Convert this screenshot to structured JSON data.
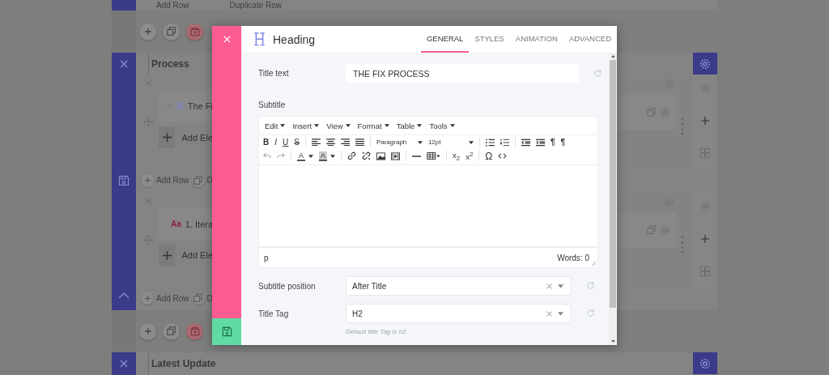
{
  "builder": {
    "top_row": {
      "add": "Add Row",
      "duplicate": "Duplicate Row"
    },
    "sections": [
      {
        "title": "Process",
        "rows": [
          {
            "kind": "heading",
            "label": "The Fi",
            "add_label": "Add Ele",
            "add_row": "Add Row",
            "duplicate": "D"
          },
          {
            "kind": "text",
            "badge": "Aa",
            "label": "1. Itera",
            "add_label": "Add Ele",
            "add_row": "Add Row",
            "duplicate": "D"
          }
        ]
      },
      {
        "title": "Latest Update"
      }
    ]
  },
  "modal": {
    "title": "Heading",
    "tabs": [
      {
        "label": "GENERAL",
        "selected": true
      },
      {
        "label": "STYLES",
        "selected": false
      },
      {
        "label": "ANIMATION",
        "selected": false
      },
      {
        "label": "ADVANCED",
        "selected": false
      }
    ],
    "fields": [
      {
        "kind": "text",
        "label": "Title text",
        "value": "THE FIX PROCESS"
      },
      {
        "kind": "editor",
        "label": "Subtitle",
        "menus": [
          "Edit",
          "Insert",
          "View",
          "Format",
          "Table",
          "Tools"
        ],
        "glyphs": [
          "B",
          "I",
          "U",
          "S"
        ],
        "block_format": "Paragraph",
        "font_size": "12pt",
        "pilcrows": [
          "¶",
          "¶"
        ],
        "color_glyphs": [
          "A",
          "A"
        ],
        "subscript": "x$_{2}$",
        "superscript": "x$^{2}$",
        "special": "Ω",
        "path": "p",
        "word_count": "Words: 0"
      },
      {
        "kind": "select",
        "label": "Subtitle position",
        "value": "After Title"
      },
      {
        "kind": "select",
        "label": "Title Tag",
        "value": "H2",
        "hint": "Default title Tag is h2"
      }
    ]
  }
}
